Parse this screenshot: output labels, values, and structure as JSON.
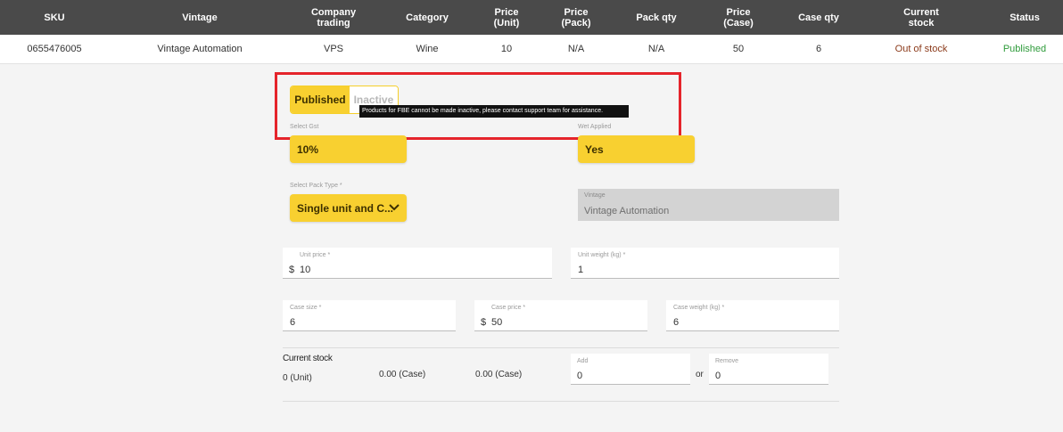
{
  "table": {
    "headers": [
      "SKU",
      "Vintage",
      "Company\ntrading",
      "Category",
      "Price\n(Unit)",
      "Price\n(Pack)",
      "Pack qty",
      "Price\n(Case)",
      "Case qty",
      "Current\nstock",
      "Status"
    ],
    "row": [
      "0655476005",
      "Vintage Automation",
      "VPS",
      "Wine",
      "10",
      "N/A",
      "N/A",
      "50",
      "6",
      "Out of stock",
      "Published"
    ]
  },
  "status_toggle": {
    "published_label": "Published",
    "inactive_label": "Inactive",
    "selected": "Published",
    "tooltip": "Products for FBE cannot be made inactive, please contact support team for assistance."
  },
  "gst": {
    "label": "Select Gst",
    "value": "10%"
  },
  "wet": {
    "label": "Wet Applied",
    "value": "Yes"
  },
  "pack_type": {
    "label": "Select Pack Type *",
    "value": "Single unit and C..."
  },
  "vintage": {
    "label": "Vintage",
    "value": "Vintage Automation"
  },
  "unit_price": {
    "label": "Unit price *",
    "prefix": "$",
    "value": "10"
  },
  "unit_weight": {
    "label": "Unit weight (kg) *",
    "value": "1"
  },
  "case_size": {
    "label": "Case size *",
    "value": "6"
  },
  "case_price": {
    "label": "Case price *",
    "prefix": "$",
    "value": "50"
  },
  "case_weight": {
    "label": "Case weight (kg) *",
    "value": "6"
  },
  "stock": {
    "title": "Current stock",
    "units": "0 (Unit)",
    "case_a": "0.00 (Case)",
    "case_b": "0.00 (Case)",
    "add_label": "Add",
    "add_value": "0",
    "or": "or",
    "remove_label": "Remove",
    "remove_value": "0"
  },
  "colors": {
    "accent_yellow": "#f8d030",
    "header_bg": "#4a4a4a",
    "highlight_red": "#e5242b",
    "published_green": "#2e9b3a",
    "out_of_stock": "#8b3a1a"
  }
}
